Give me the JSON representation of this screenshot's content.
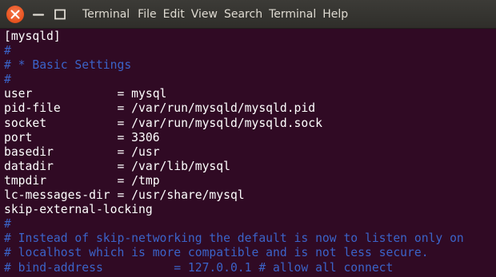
{
  "menu": {
    "title": "Terminal",
    "items": [
      "File",
      "Edit",
      "View",
      "Search",
      "Terminal",
      "Help"
    ]
  },
  "terminal": {
    "lines": [
      {
        "text": "[mysqld]",
        "type": "normal"
      },
      {
        "text": "#",
        "type": "comment"
      },
      {
        "text": "# * Basic Settings",
        "type": "comment"
      },
      {
        "text": "#",
        "type": "comment"
      },
      {
        "text": "user            = mysql",
        "type": "normal"
      },
      {
        "text": "pid-file        = /var/run/mysqld/mysqld.pid",
        "type": "normal"
      },
      {
        "text": "socket          = /var/run/mysqld/mysqld.sock",
        "type": "normal"
      },
      {
        "text": "port            = 3306",
        "type": "normal"
      },
      {
        "text": "basedir         = /usr",
        "type": "normal"
      },
      {
        "text": "datadir         = /var/lib/mysql",
        "type": "normal"
      },
      {
        "text": "tmpdir          = /tmp",
        "type": "normal"
      },
      {
        "text": "lc-messages-dir = /usr/share/mysql",
        "type": "normal"
      },
      {
        "text": "skip-external-locking",
        "type": "normal"
      },
      {
        "text": "#",
        "type": "comment"
      },
      {
        "text": "# Instead of skip-networking the default is now to listen only on",
        "type": "comment"
      },
      {
        "text": "# localhost which is more compatible and is not less secure.",
        "type": "comment"
      },
      {
        "text": "# bind-address          = 127.0.0.1 # allow all connect",
        "type": "comment"
      }
    ]
  },
  "colors": {
    "background": "#300a24",
    "text": "#ffffff",
    "comment": "#3b63c8",
    "close_button": "#e95420",
    "titlebar": "#3c3b37"
  }
}
